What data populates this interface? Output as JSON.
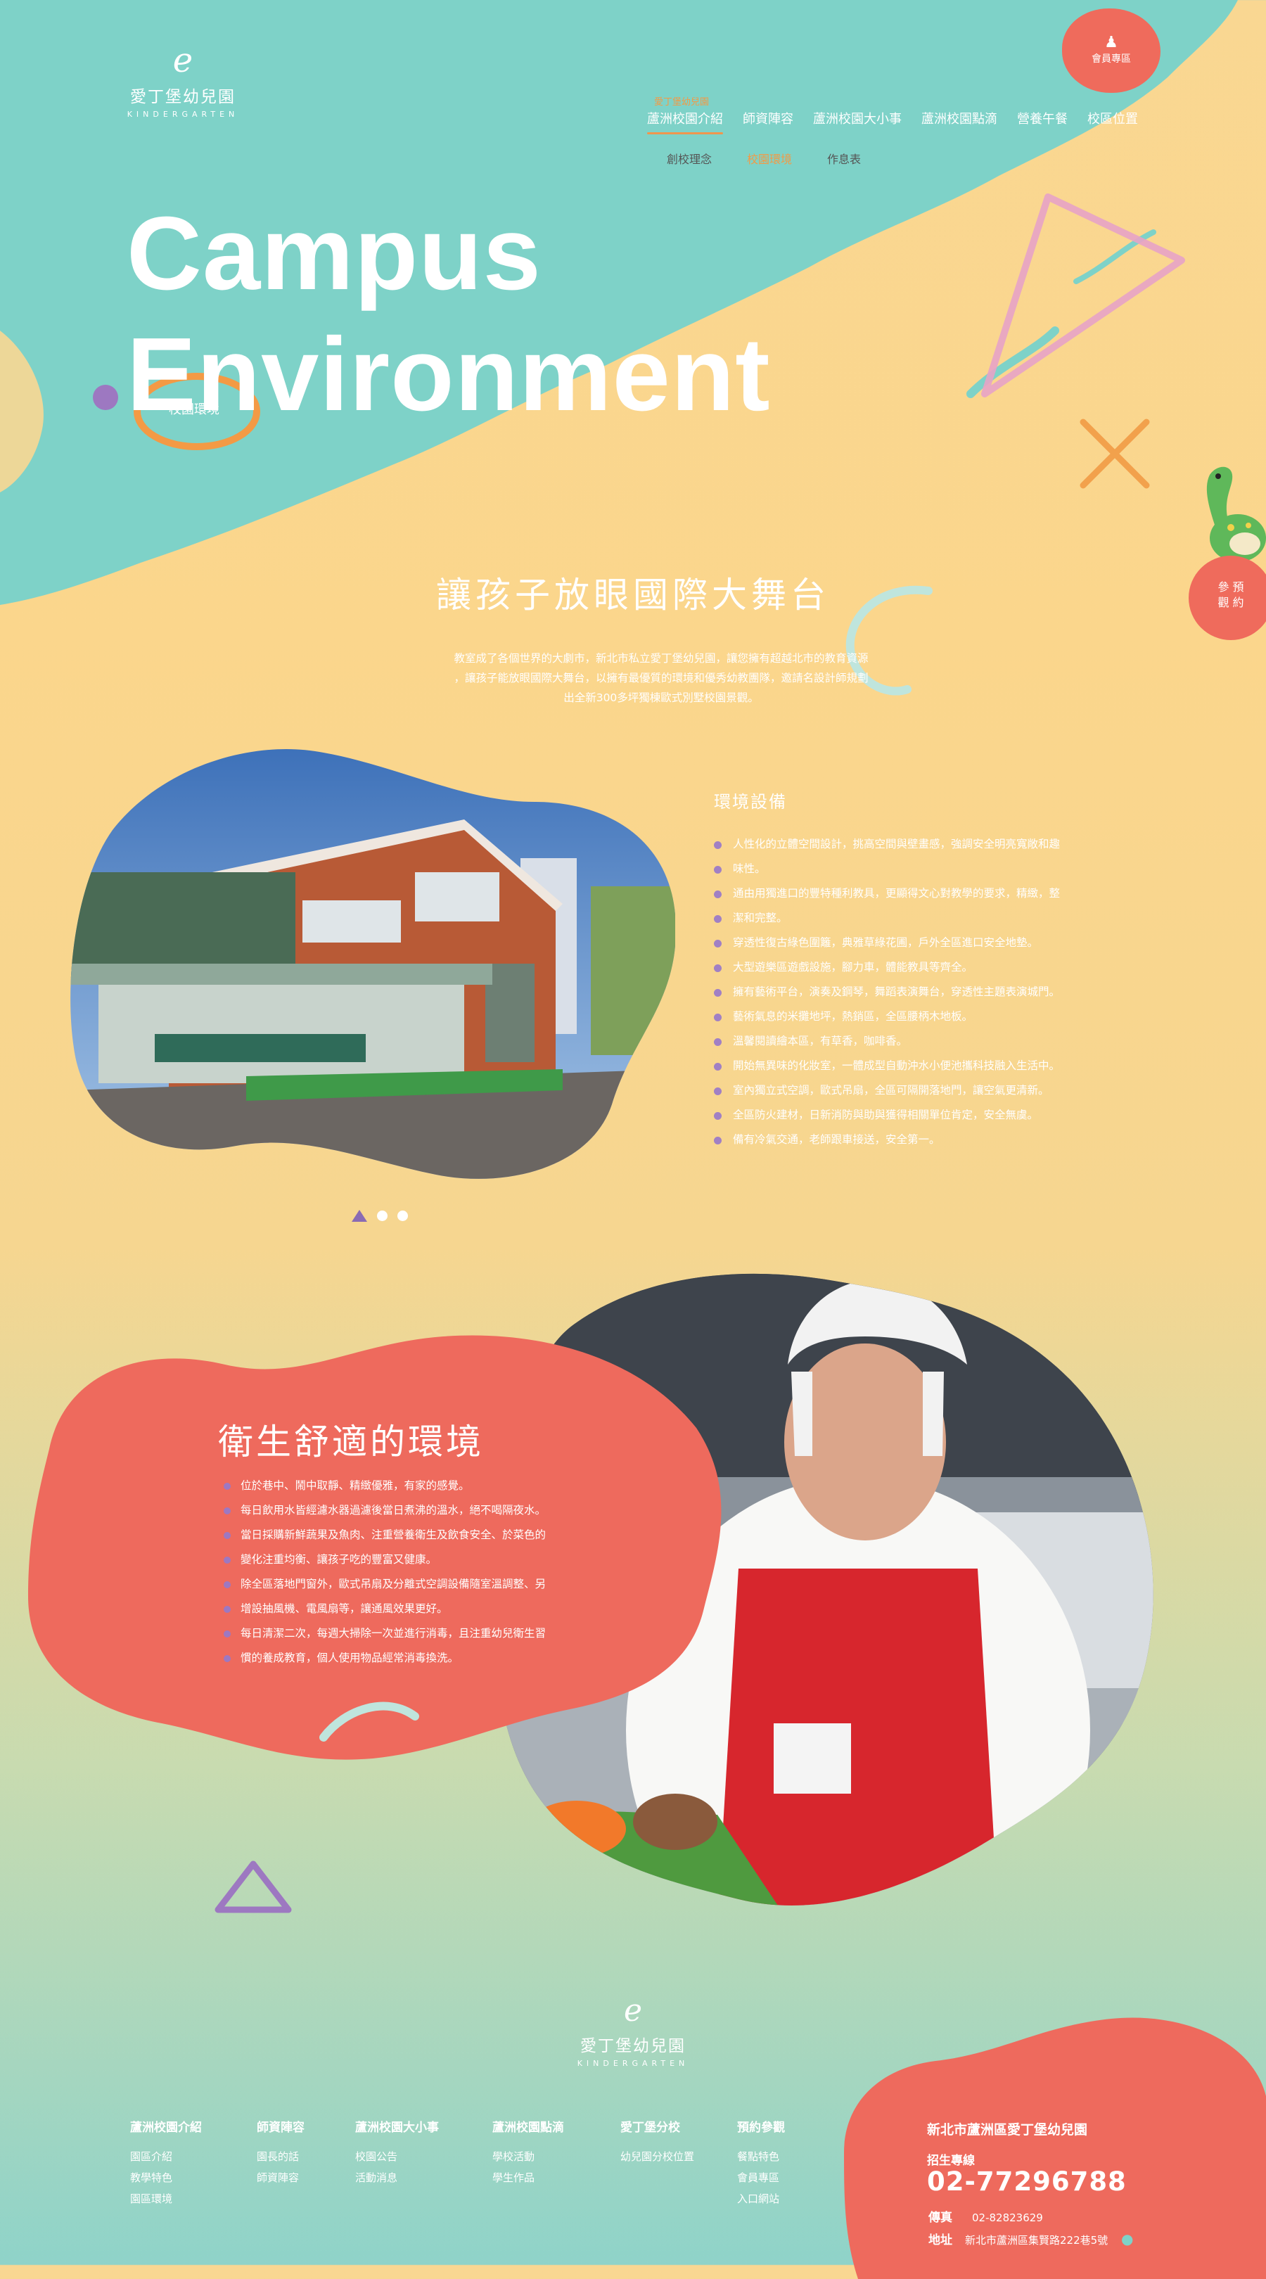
{
  "header": {
    "logo": {
      "mark": "e",
      "name": "愛丁堡幼兒園",
      "sub": "KINDERGARTEN"
    },
    "member_label": "會員專區",
    "nav_top_label": "愛丁堡幼兒園",
    "nav": [
      "蘆洲校園介紹",
      "師資陣容",
      "蘆洲校園大小事",
      "蘆洲校園點滴",
      "營養午餐",
      "校區位置"
    ],
    "subnav": [
      "創校理念",
      "校園環境",
      "作息表"
    ]
  },
  "hero": {
    "title_line1": "Campus",
    "title_line2": "Environment",
    "subtitle": "校園環境"
  },
  "visit_label_1": "參 預",
  "visit_label_2": "觀 約",
  "intro": {
    "heading": "讓孩子放眼國際大舞台",
    "lines": [
      "教室成了各個世界的大劇市，新北市私立愛丁堡幼兒園，讓您擁有超越北市的教育資源",
      "，讓孩子能放眼國際大舞台，以擁有最優質的環境和優秀幼教團隊，邀請名設計師規劃",
      "出全新300多坪獨棟歐式別墅校園景觀。"
    ]
  },
  "environment": {
    "title": "環境設備",
    "items": [
      "人性化的立體空間設計，挑高空間與壁畫感，強調安全明亮寬敞和趣",
      "味性。",
      "通由用獨進口的豐特種利教具，更顯得文心對教學的要求，精緻，整",
      "潔和完整。",
      "穿透性復古綠色圍籬，典雅草綠花圃，戶外全區進口安全地墊。",
      "大型遊樂區遊戲設施，腳力車，體能教具等齊全。",
      "擁有藝術平台，演奏及鋼琴，舞蹈表演舞台，穿透性主題表演城門。",
      "藝術氣息的米攤地坪，熱銷區，全區腰柄木地板。",
      "溫馨閱讀繪本區，有草香，咖啡香。",
      "開始無異味的化妝室，一體成型自動沖水小便池攜科技融入生活中。",
      "室內獨立式空調，歐式吊扇，全區可隔開落地門，讓空氣更清新。",
      "全區防火建材，日新消防與助與獲得相關單位肯定，安全無虞。",
      "備有冷氣交通，老師跟車接送，安全第一。"
    ]
  },
  "hygiene": {
    "title": "衛生舒適的環境",
    "items": [
      "位於巷中、鬧中取靜、精緻優雅，有家的感覺。",
      "每日飲用水皆經濾水器過濾後當日煮沸的溫水，絕不喝隔夜水。",
      "當日採購新鮮蔬果及魚肉、注重營養衛生及飲食安全、於菜色的",
      "變化注重均衡、讓孩子吃的豐富又健康。",
      "除全區落地門窗外，歐式吊扇及分離式空調設備隨室溫調整、另",
      "增設抽風機、電風扇等，讓通風效果更好。",
      "每日清潔二次，每週大掃除一次並進行消毒，且注重幼兒衛生習",
      "慣的養成教育，個人使用物品經常消毒換洗。"
    ]
  },
  "footer": {
    "logo": {
      "mark": "e",
      "name": "愛丁堡幼兒園",
      "sub": "KINDERGARTEN"
    },
    "columns": [
      {
        "title": "蘆洲校園介紹",
        "items": [
          "園區介紹",
          "教學特色",
          "園區環境"
        ]
      },
      {
        "title": "師資陣容",
        "items": [
          "園長的話",
          "師資陣容"
        ]
      },
      {
        "title": "蘆洲校園大小事",
        "items": [
          "校園公告",
          "活動消息"
        ]
      },
      {
        "title": "蘆洲校園點滴",
        "items": [
          "學校活動",
          "學生作品"
        ]
      },
      {
        "title": "愛丁堡分校",
        "items": [
          "幼兒園分校位置"
        ]
      },
      {
        "title": "預約參觀",
        "items": [
          "餐點特色",
          "會員專區",
          "入口網站"
        ]
      }
    ],
    "contact": {
      "title": "新北市蘆洲區愛丁堡幼兒園",
      "hotline_label": "招生專線",
      "phone": "02-77296788",
      "fax_label": "傳真",
      "fax": "02-82823629",
      "address_label": "地址",
      "address": "新北市蘆洲區集賢路222巷5號"
    }
  },
  "colors": {
    "teal": "#7ed2c8",
    "coral": "#ef6b5c",
    "yellow": "#f9d792",
    "purple": "#9d78c1",
    "orange": "#f39a45"
  }
}
